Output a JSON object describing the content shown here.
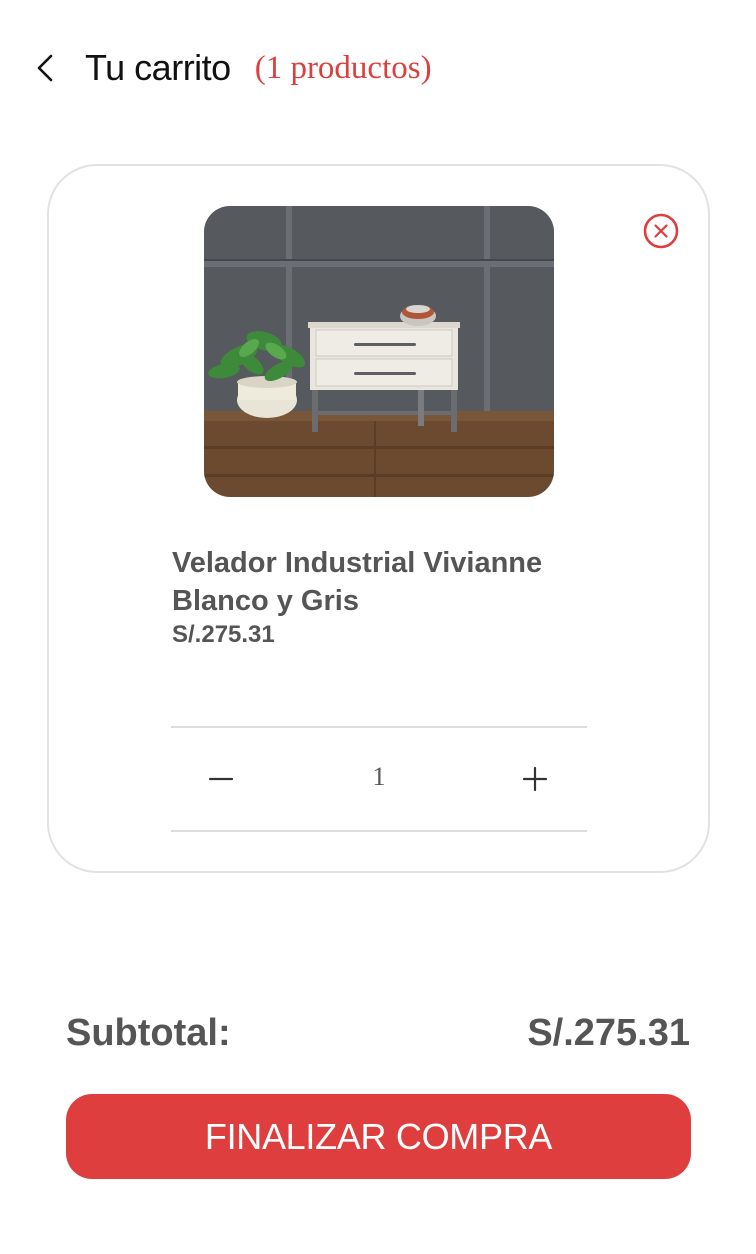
{
  "header": {
    "title": "Tu carrito",
    "count_text": "(1 productos)"
  },
  "cart": {
    "items": [
      {
        "name": "Velador Industrial Vivianne Blanco y Gris",
        "price": "S/.275.31",
        "quantity": "1",
        "image_icon": "nightstand-photo"
      }
    ]
  },
  "summary": {
    "subtotal_label": "Subtotal:",
    "subtotal_value": "S/.275.31",
    "checkout_label": "FINALIZAR COMPRA"
  },
  "colors": {
    "accent": "#de3f3e",
    "text_muted": "#555555",
    "border": "#e2e2e2"
  }
}
